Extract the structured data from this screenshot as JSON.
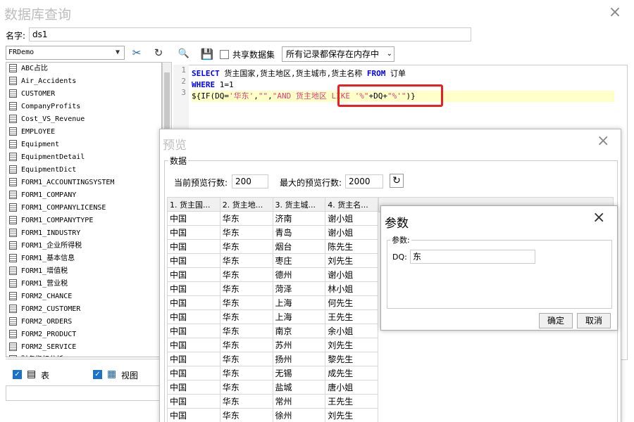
{
  "window": {
    "title": "数据库查询",
    "close_icon": "×"
  },
  "name_field": {
    "label": "名字:",
    "value": "ds1"
  },
  "datasource": {
    "selected": "FRDemo"
  },
  "tables": [
    "ABC占比",
    "Air_Accidents",
    "CUSTOMER",
    "CompanyProfits",
    "Cost_VS_Revenue",
    "EMPLOYEE",
    "Equipment",
    "EquipmentDetail",
    "EquipmentDict",
    "FORM1_ACCOUNTINGSYSTEM",
    "FORM1_COMPANY",
    "FORM1_COMPANYLICENSE",
    "FORM1_COMPANYTYPE",
    "FORM1_INDUSTRY",
    "FORM1_企业所得税",
    "FORM1_基本信息",
    "FORM1_增值税",
    "FORM1_营业税",
    "FORM2_CHANCE",
    "FORM2_CUSTOMER",
    "FORM2_ORDERS",
    "FORM2_PRODUCT",
    "FORM2_SERVICE",
    "财务指标分析"
  ],
  "filters": {
    "table_label": "表",
    "view_label": "视图"
  },
  "sql_toolbar": {
    "share_label": "共享数据集",
    "storage_mode": "所有记录都保存在内存中"
  },
  "sql": {
    "line_numbers": [
      "1",
      "2",
      "3"
    ],
    "line1": {
      "kw1": "SELECT",
      "t1": " 货主国家,货主地区,货主城市,货主名称 ",
      "kw2": "FROM",
      "t2": " 订单"
    },
    "line2": {
      "kw1": "WHERE",
      "t1": " 1=1"
    },
    "line3": {
      "p1": "${IF(DQ=",
      "s1": "'华东'",
      "p2": ",",
      "s2": "\"\"",
      "p3": ",",
      "s3": "\"AND 货主地区 LIKE '%\"",
      "p4": "+DQ+",
      "s4": "\"%'\"",
      "p5": ")}"
    }
  },
  "preview": {
    "title": "预览",
    "group_label": "数据",
    "current_rows_label": "当前预览行数:",
    "current_rows_value": "200",
    "max_rows_label": "最大的预览行数:",
    "max_rows_value": "2000",
    "columns": [
      "1. 货主国...",
      "2. 货主地...",
      "3. 货主城...",
      "4. 货主名..."
    ],
    "rows": [
      [
        "中国",
        "华东",
        "济南",
        "谢小姐"
      ],
      [
        "中国",
        "华东",
        "青岛",
        "谢小姐"
      ],
      [
        "中国",
        "华东",
        "烟台",
        "陈先生"
      ],
      [
        "中国",
        "华东",
        "枣庄",
        "刘先生"
      ],
      [
        "中国",
        "华东",
        "德州",
        "谢小姐"
      ],
      [
        "中国",
        "华东",
        "菏泽",
        "林小姐"
      ],
      [
        "中国",
        "华东",
        "上海",
        "何先生"
      ],
      [
        "中国",
        "华东",
        "上海",
        "王先生"
      ],
      [
        "中国",
        "华东",
        "南京",
        "余小姐"
      ],
      [
        "中国",
        "华东",
        "苏州",
        "刘先生"
      ],
      [
        "中国",
        "华东",
        "扬州",
        "黎先生"
      ],
      [
        "中国",
        "华东",
        "无锡",
        "成先生"
      ],
      [
        "中国",
        "华东",
        "盐城",
        "唐小姐"
      ],
      [
        "中国",
        "华东",
        "常州",
        "王先生"
      ],
      [
        "中国",
        "华东",
        "徐州",
        "刘先生"
      ]
    ]
  },
  "params": {
    "title": "参数",
    "group_label": "参数:",
    "field_label": "DQ:",
    "field_value": "东",
    "ok_label": "确定",
    "cancel_label": "取消"
  }
}
